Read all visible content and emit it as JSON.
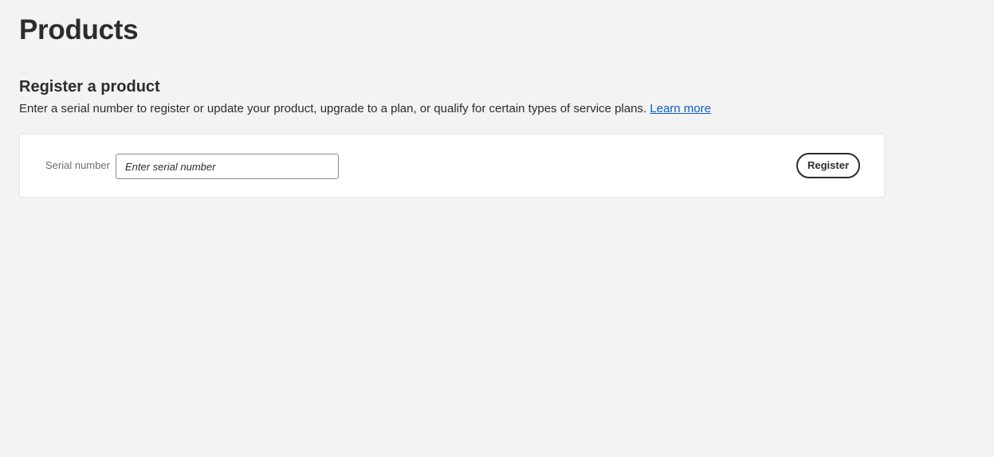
{
  "page": {
    "title": "Products"
  },
  "register_section": {
    "title": "Register a product",
    "description": "Enter a serial number to register or update your product, upgrade to a plan, or qualify for certain types of service plans.",
    "learn_more_label": "Learn more"
  },
  "form": {
    "serial_label": "Serial number",
    "serial_value": "",
    "serial_placeholder": "Enter serial number",
    "register_button_label": "Register"
  },
  "colors": {
    "background": "#f3f3f3",
    "card": "#ffffff",
    "text": "#2c2c2c",
    "link": "#0d5ec6",
    "label": "#6e6e6e"
  }
}
